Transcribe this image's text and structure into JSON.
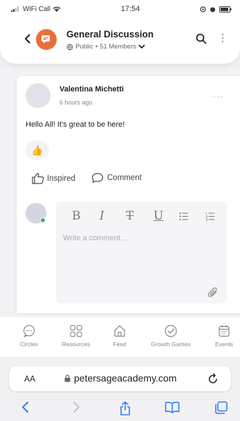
{
  "status_bar": {
    "carrier": "WiFi Call",
    "time": "17:54"
  },
  "group": {
    "title": "General Discussion",
    "visibility": "Public",
    "member_count": "51 Members",
    "separator": "•",
    "avatar_color": "#e8703a"
  },
  "post": {
    "author": "Valentina Michetti",
    "time_ago": "6 hours ago",
    "more": "···",
    "text": "Hello All! It's great to be here!",
    "reaction_emoji": "👍",
    "inspired_label": "Inspired",
    "comment_label": "Comment"
  },
  "composer": {
    "placeholder": "Write a comment...",
    "bold": "B",
    "italic": "I",
    "strike": "T",
    "underline": "U",
    "online_color": "#3cb371"
  },
  "tabs": [
    {
      "label": "Circles",
      "icon": "chat-bubble-icon"
    },
    {
      "label": "Resources",
      "icon": "grid-icon"
    },
    {
      "label": "Feed",
      "icon": "home-icon"
    },
    {
      "label": "Growth Games",
      "icon": "check-circle-icon"
    },
    {
      "label": "Events",
      "icon": "calendar-icon"
    }
  ],
  "browser": {
    "aa": "AA",
    "url": "petersageacademy.com"
  }
}
